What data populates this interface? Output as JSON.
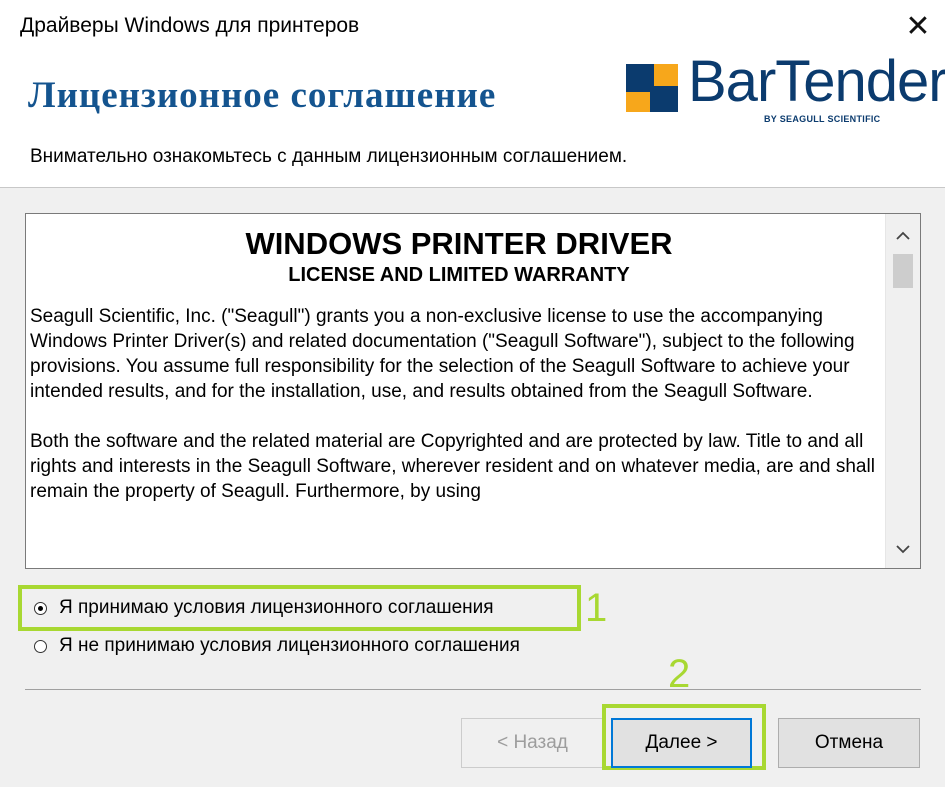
{
  "window": {
    "title": "Драйверы Windows для принтеров",
    "close_icon": "close-icon"
  },
  "header": {
    "heading": "Лицензионное соглашение",
    "subheading": "Внимательно ознакомьтесь с данным лицензионным соглашением.",
    "logo": {
      "word": "BarTender",
      "tagline": "BY SEAGULL SCIENTIFIC",
      "color": "#0b3b6e",
      "accent": "#f7a71b"
    }
  },
  "license": {
    "title": "WINDOWS PRINTER DRIVER",
    "subtitle": "LICENSE AND LIMITED WARRANTY",
    "paragraphs": [
      "Seagull Scientific, Inc. (\"Seagull\") grants you a non-exclusive license to use the accompanying Windows Printer Driver(s) and related documentation (\"Seagull Software\"), subject to the following provisions.  You assume full responsibility for the selection of the Seagull Software to achieve your intended results, and for the installation, use, and results obtained from the Seagull Software.",
      "Both the software and the related material are Copyrighted and are protected by law. Title to and all rights and interests in the Seagull Software, wherever resident and on whatever media, are and shall remain the property of Seagull.  Furthermore, by using"
    ]
  },
  "options": {
    "accept": "Я принимаю условия лицензионного соглашения",
    "decline": "Я не принимаю условия лицензионного соглашения",
    "selected": "accept"
  },
  "annotations": {
    "marker_1": "1",
    "marker_2": "2",
    "color": "#a8d832"
  },
  "buttons": {
    "back": "< Назад",
    "next": "Далее >",
    "cancel": "Отмена"
  }
}
